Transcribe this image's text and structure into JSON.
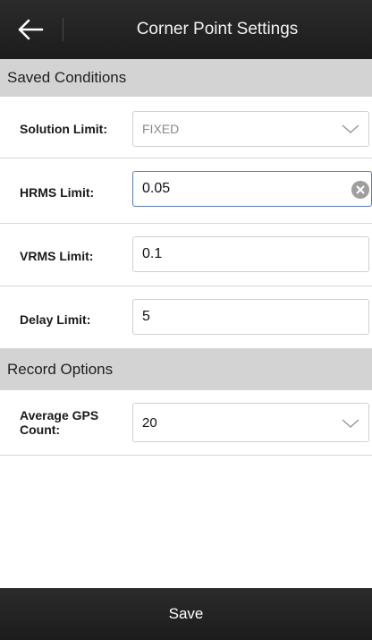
{
  "header": {
    "title": "Corner Point Settings"
  },
  "saved_conditions": {
    "section_label": "Saved Conditions",
    "solution_limit": {
      "label": "Solution Limit:",
      "value": "FIXED"
    },
    "hrms_limit": {
      "label": "HRMS Limit:",
      "value": "0.05"
    },
    "vrms_limit": {
      "label": "VRMS Limit:",
      "value": "0.1"
    },
    "delay_limit": {
      "label": "Delay Limit:",
      "value": "5"
    }
  },
  "record_options": {
    "section_label": "Record Options",
    "average_gps_count": {
      "label": "Average GPS Count:",
      "value": "20"
    }
  },
  "footer": {
    "save_label": "Save"
  },
  "colors": {
    "bar_background": "#222222",
    "section_background": "#d3d3d3",
    "focus_border": "#5a7ab8"
  },
  "icons": {
    "back": "arrow-left-icon",
    "dropdown": "chevron-down-icon",
    "clear": "clear-icon"
  }
}
